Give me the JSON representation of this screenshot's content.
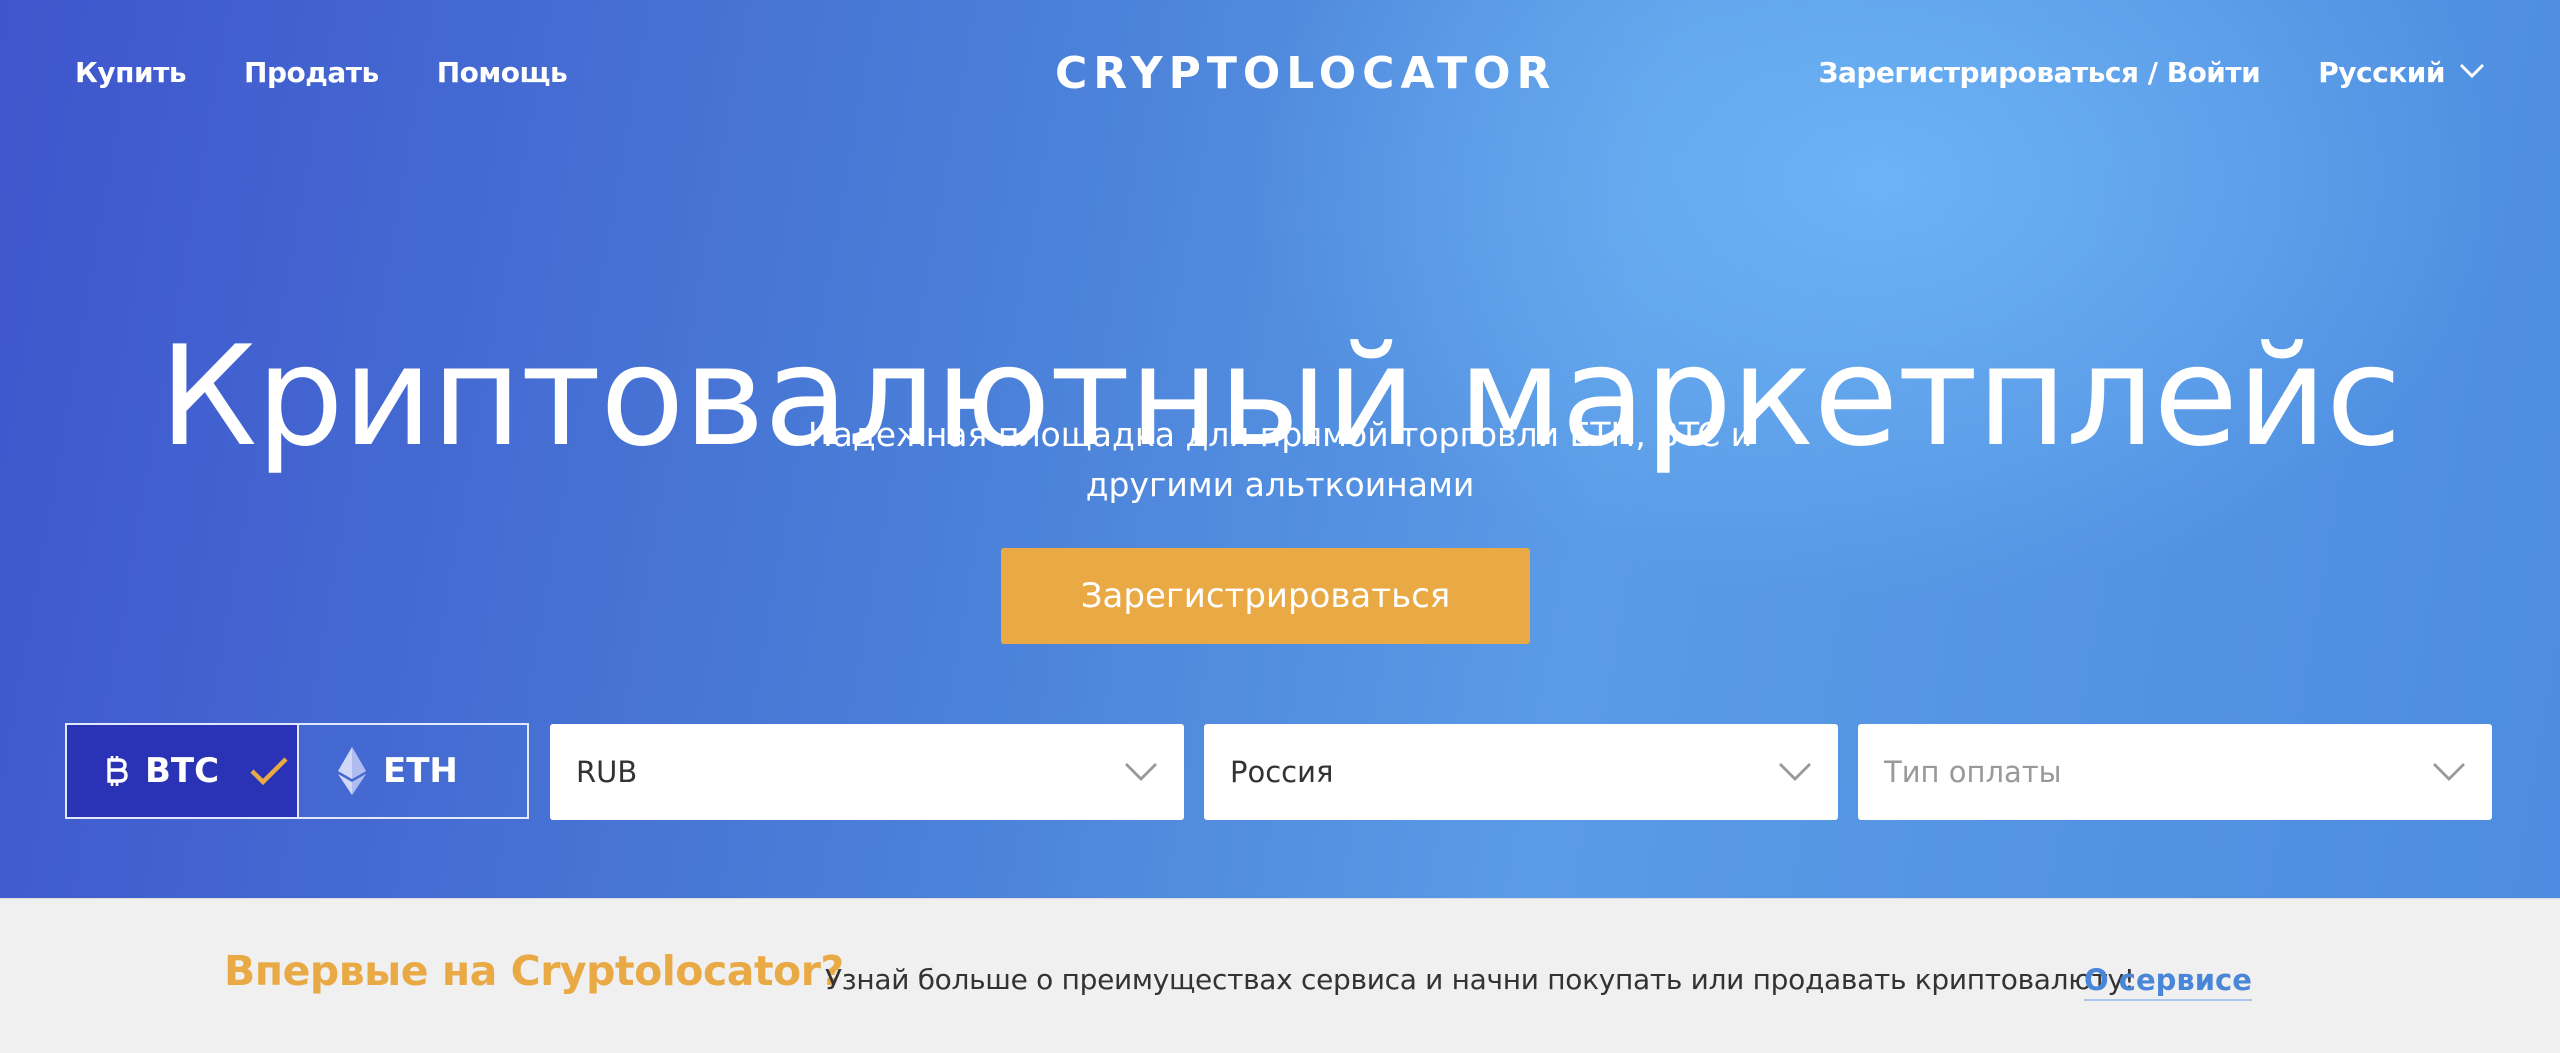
{
  "nav": {
    "left_items": [
      "Купить",
      "Продать",
      "Помощь"
    ],
    "logo_text": "CRYPTOLOCATOR",
    "auth_label": "Зарегистрироваться / Войти",
    "language": "Русский"
  },
  "hero": {
    "headline": "Криптовалютный маркетплейс",
    "subtitle": "Надежная площадка для прямой торговли ETH, BTC и другими альткоинами",
    "register_button": "Зарегистрироваться"
  },
  "filters": {
    "coins": [
      {
        "label": "BTC",
        "selected": true,
        "icon": "bitcoin-icon"
      },
      {
        "label": "ETH",
        "selected": false,
        "icon": "ethereum-icon"
      }
    ],
    "currency": "RUB",
    "country": "Россия",
    "payment_placeholder": "Тип оплаты"
  },
  "info": {
    "title": "Впервые на Cryptolocator?",
    "text": "Узнай больше о преимуществах сервиса и начни покупать или продавать криптовалюту!",
    "link": "О сервисе"
  },
  "colors": {
    "accent": "#e9a944",
    "active_coin": "#2a33b5",
    "link": "#4a86d8"
  }
}
